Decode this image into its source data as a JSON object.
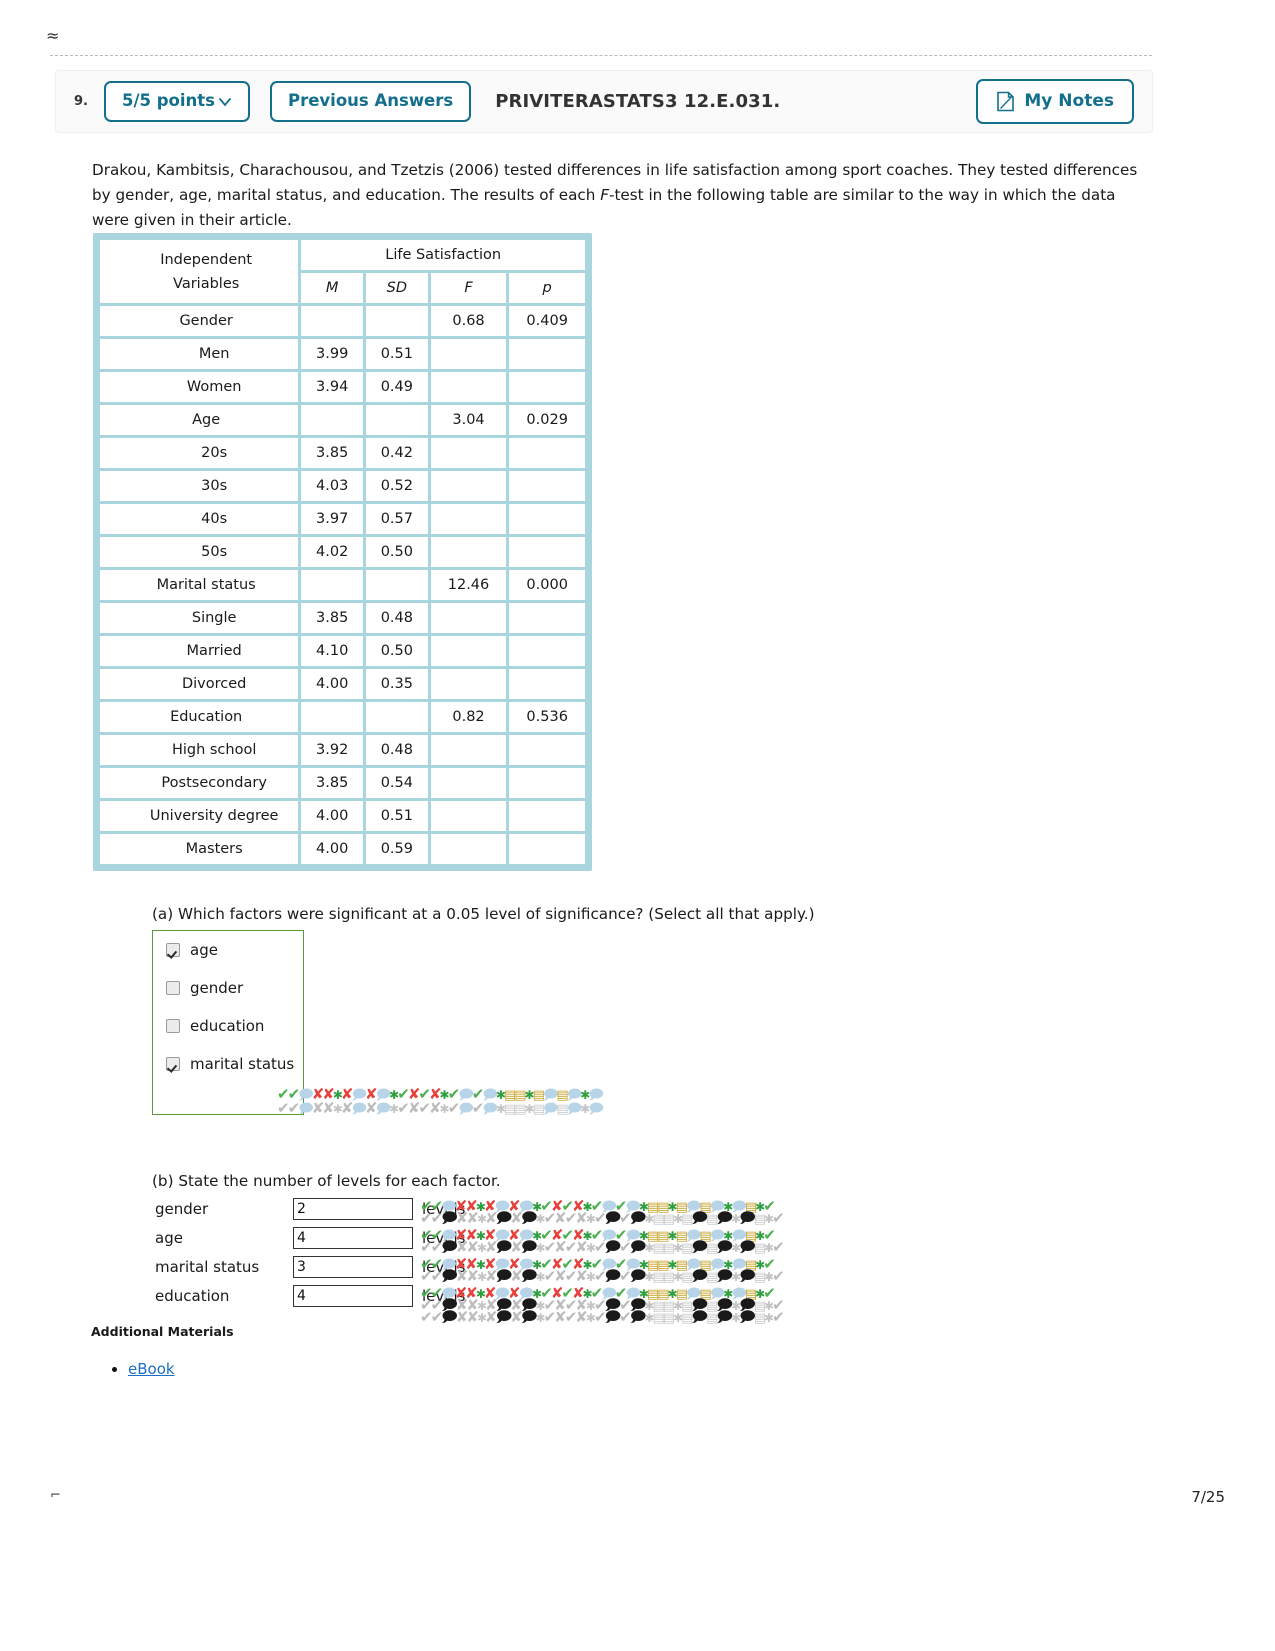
{
  "page": {
    "top_glyph": "≈",
    "footer_left": "⌐",
    "footer_right": "7/25"
  },
  "question_header": {
    "number": "9.",
    "points_label": "5/5 points",
    "points_chevron_icon": "chevron-down-icon",
    "previous_answers_label": "Previous Answers",
    "question_code": "PRIVITERASTATS3 12.E.031.",
    "my_notes_label": "My Notes",
    "my_notes_icon": "note-page-icon",
    "accent_color": "#136f8b"
  },
  "prompt": {
    "line1": "Drakou, Kambitsis, Charachousou, and Tzetzis (2006) tested differences in life satisfaction among sport coaches. They tested differences",
    "line2a": "by gender, age, marital status, and education. The results of each ",
    "line2i": "F",
    "line2b": "-test in the following table are similar to the way in which the data",
    "line3": "were given in their article."
  },
  "table": {
    "corner_header": "Independent Variables",
    "corner_header_line1": "Independent",
    "corner_header_line2": "Variables",
    "group_header": "Life Satisfaction",
    "columns": [
      "M",
      "SD",
      "F",
      "p"
    ],
    "border_color": "#a8d5de",
    "rows": [
      {
        "label": "Gender",
        "level": 0,
        "M": "",
        "SD": "",
        "F": "0.68",
        "p": "0.409"
      },
      {
        "label": "Men",
        "level": 1,
        "M": "3.99",
        "SD": "0.51",
        "F": "",
        "p": ""
      },
      {
        "label": "Women",
        "level": 1,
        "M": "3.94",
        "SD": "0.49",
        "F": "",
        "p": ""
      },
      {
        "label": "Age",
        "level": 0,
        "M": "",
        "SD": "",
        "F": "3.04",
        "p": "0.029"
      },
      {
        "label": "20s",
        "level": 1,
        "M": "3.85",
        "SD": "0.42",
        "F": "",
        "p": ""
      },
      {
        "label": "30s",
        "level": 1,
        "M": "4.03",
        "SD": "0.52",
        "F": "",
        "p": ""
      },
      {
        "label": "40s",
        "level": 1,
        "M": "3.97",
        "SD": "0.57",
        "F": "",
        "p": ""
      },
      {
        "label": "50s",
        "level": 1,
        "M": "4.02",
        "SD": "0.50",
        "F": "",
        "p": ""
      },
      {
        "label": "Marital status",
        "level": 0,
        "M": "",
        "SD": "",
        "F": "12.46",
        "p": "0.000"
      },
      {
        "label": "Single",
        "level": 1,
        "M": "3.85",
        "SD": "0.48",
        "F": "",
        "p": ""
      },
      {
        "label": "Married",
        "level": 1,
        "M": "4.10",
        "SD": "0.50",
        "F": "",
        "p": ""
      },
      {
        "label": "Divorced",
        "level": 1,
        "M": "4.00",
        "SD": "0.35",
        "F": "",
        "p": ""
      },
      {
        "label": "Education",
        "level": 0,
        "M": "",
        "SD": "",
        "F": "0.82",
        "p": "0.536"
      },
      {
        "label": "High school",
        "level": 1,
        "M": "3.92",
        "SD": "0.48",
        "F": "",
        "p": ""
      },
      {
        "label": "Postsecondary",
        "level": 1,
        "M": "3.85",
        "SD": "0.54",
        "F": "",
        "p": ""
      },
      {
        "label": "University degree",
        "level": 1,
        "M": "4.00",
        "SD": "0.51",
        "F": "",
        "p": ""
      },
      {
        "label": "Masters",
        "level": 1,
        "M": "4.00",
        "SD": "0.59",
        "F": "",
        "p": ""
      }
    ]
  },
  "part_a": {
    "question": "(a) Which factors were significant at a 0.05 level of significance? (Select all that apply.)",
    "group_border_color": "#5b9a3c",
    "options": [
      {
        "label": "age",
        "checked": true
      },
      {
        "label": "gender",
        "checked": false
      },
      {
        "label": "education",
        "checked": false
      },
      {
        "label": "marital status",
        "checked": true
      }
    ]
  },
  "part_b": {
    "question": "(b) State the number of levels for each factor.",
    "level_word": "levels",
    "rows": [
      {
        "label": "gender",
        "value": "2",
        "placeholder": ""
      },
      {
        "label": "age",
        "value": "4",
        "placeholder": ""
      },
      {
        "label": "marital status",
        "value": "3",
        "placeholder": ""
      },
      {
        "label": "education",
        "value": "4",
        "placeholder": ""
      }
    ]
  },
  "additional_materials": {
    "heading": "Additional Materials",
    "links": [
      "eBook"
    ]
  }
}
